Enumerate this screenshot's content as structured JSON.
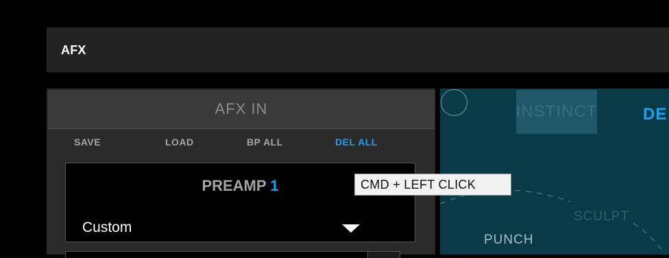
{
  "header": {
    "title": "AFX"
  },
  "afx_panel": {
    "section_title": "AFX IN",
    "actions": [
      {
        "label": "SAVE",
        "active": false
      },
      {
        "label": "LOAD",
        "active": false
      },
      {
        "label": "BP ALL",
        "active": false
      },
      {
        "label": "DEL ALL",
        "active": true
      }
    ],
    "preamp": {
      "label": "PREAMP",
      "number": "1",
      "preset_value": "Custom"
    }
  },
  "effect_panel": {
    "tabs": [
      {
        "label": "INSTINCT",
        "active": false
      },
      {
        "label": "DE",
        "active": true
      }
    ],
    "zones": [
      {
        "label": "SCULPT"
      },
      {
        "label": "PUNCH"
      }
    ]
  },
  "tooltip": {
    "text": "CMD + LEFT CLICK"
  },
  "colors": {
    "accent_blue": "#19a3f1",
    "teal_panel": "#083a47",
    "header_bg": "#232323",
    "panel_bg": "#2a2a2a"
  }
}
